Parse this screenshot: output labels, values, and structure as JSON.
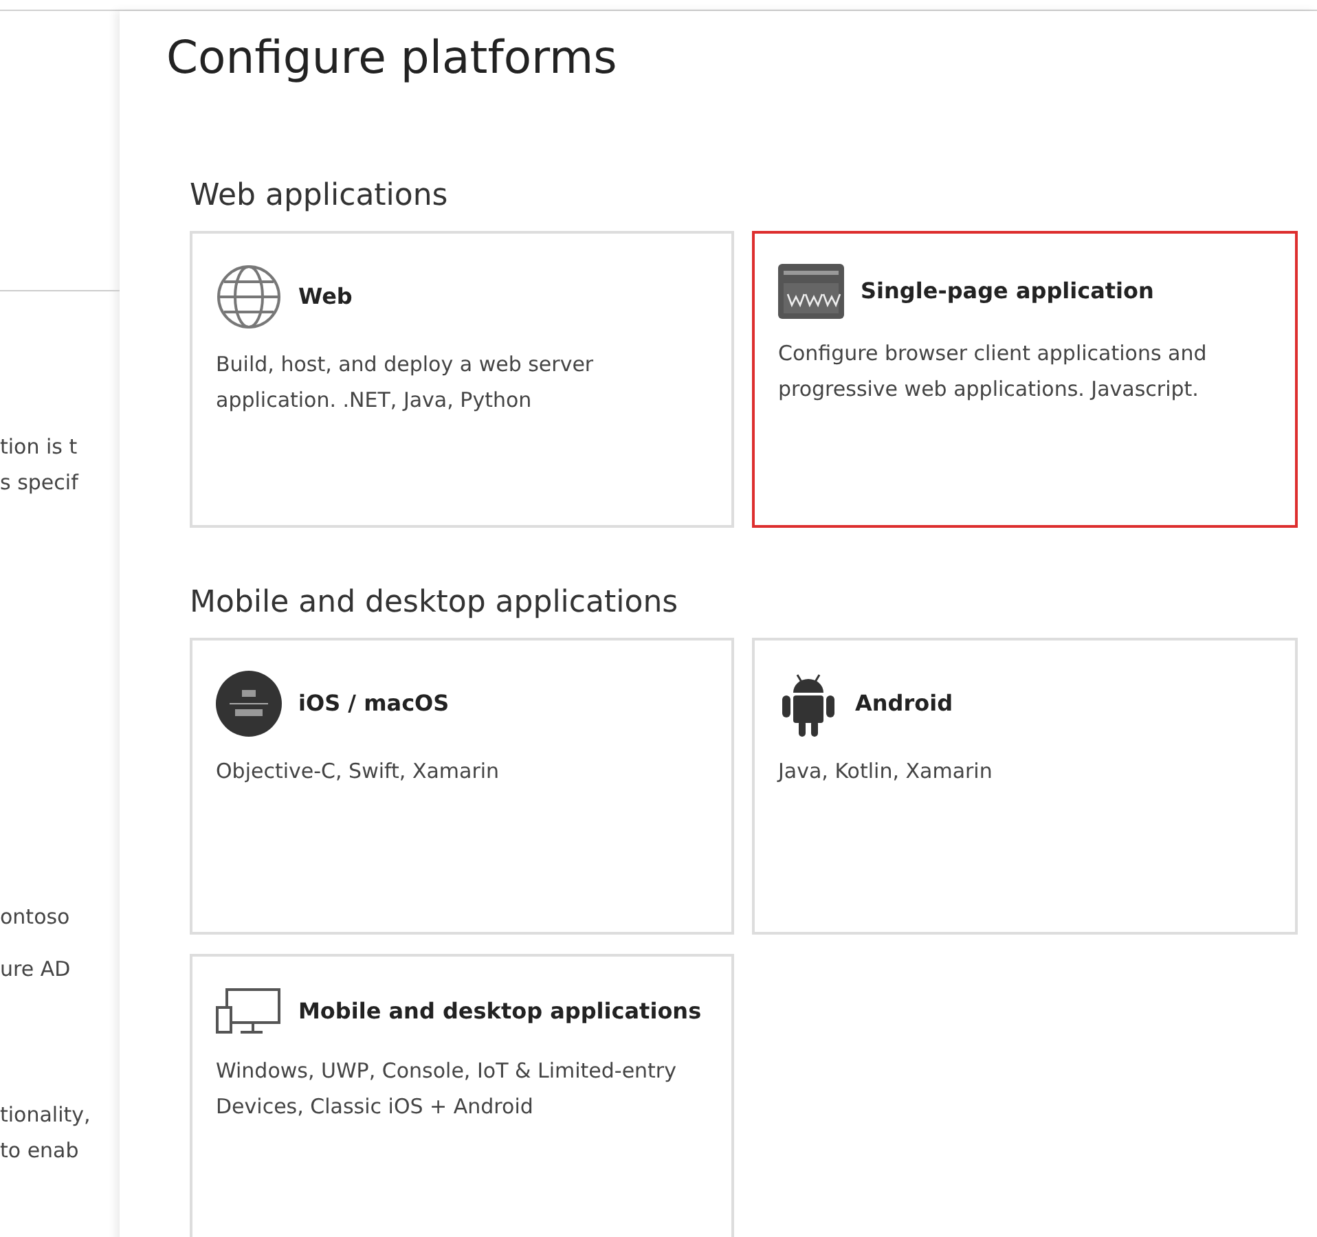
{
  "background_text": [
    "tion is t",
    "s specif",
    "ontoso",
    "ure AD",
    "tionality,",
    "to enab"
  ],
  "panel": {
    "title": "Configure platforms",
    "sections": [
      {
        "heading": "Web applications",
        "platforms": [
          {
            "kind": "globe",
            "name": "Web",
            "description": "Build, host, and deploy a web server application. .NET, Java, Python",
            "selected": false
          },
          {
            "kind": "www",
            "name": "Single-page application",
            "description": "Configure browser client applications and progressive web applications. Javascript.",
            "selected": true
          }
        ]
      },
      {
        "heading": "Mobile and desktop applications",
        "platforms": [
          {
            "kind": "ios",
            "name": "iOS / macOS",
            "description": "Objective-C, Swift, Xamarin",
            "selected": false
          },
          {
            "kind": "android",
            "name": "Android",
            "description": "Java, Kotlin, Xamarin",
            "selected": false
          },
          {
            "kind": "devices",
            "name": "Mobile and desktop applications",
            "description": "Windows, UWP, Console, IoT & Limited-entry Devices, Classic iOS + Android",
            "selected": false
          }
        ]
      }
    ]
  }
}
